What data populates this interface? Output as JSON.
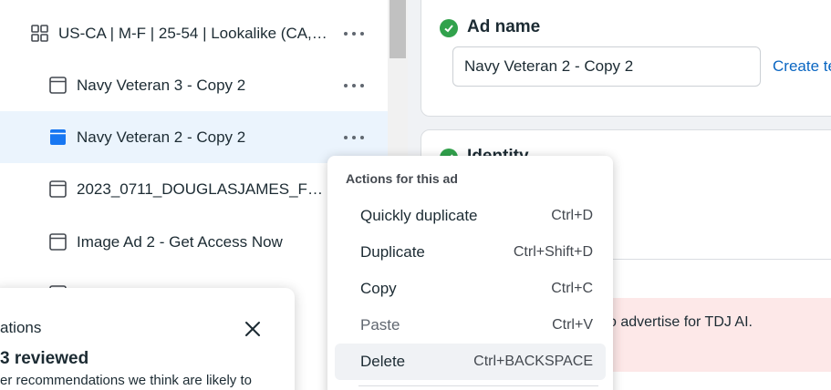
{
  "tree": {
    "rows": [
      {
        "label": "US-CA | M-F | 25-54 | Lookalike (CA, ...",
        "icon": "ad-set-grid-icon"
      },
      {
        "label": "Navy Veteran 3 - Copy 2",
        "icon": "ad-icon"
      },
      {
        "label": "Navy Veteran 2 - Copy 2",
        "icon": "ad-icon-selected"
      },
      {
        "label": "2023_0711_DOUGLASJAMES_FB...",
        "icon": "ad-icon"
      },
      {
        "label": "Image Ad 2 - Get Access Now",
        "icon": "ad-icon"
      }
    ],
    "more_icon": "more-horizontal-icon"
  },
  "editor": {
    "ad_name_title": "Ad name",
    "ad_name_value": "Navy Veteran 2 - Copy 2",
    "create_link": "Create ten",
    "identity_title": "Identity",
    "error_text": "o advertise for TDJ AI."
  },
  "menu": {
    "header": "Actions for this ad",
    "items": [
      {
        "label": "Quickly duplicate",
        "shortcut": "Ctrl+D"
      },
      {
        "label": "Duplicate",
        "shortcut": "Ctrl+Shift+D"
      },
      {
        "label": "Copy",
        "shortcut": "Ctrl+C"
      },
      {
        "label": "Paste",
        "shortcut": "Ctrl+V"
      },
      {
        "label": "Delete",
        "shortcut": "Ctrl+BACKSPACE"
      }
    ]
  },
  "recommendations": {
    "title": "ations",
    "reviewed": "3 reviewed",
    "description": "er recommendations we think are likely to"
  },
  "colors": {
    "selected_row": "#ebf4fd",
    "accent_blue": "#1877f2",
    "link_blue": "#0a66c2",
    "success_green": "#31a24c",
    "error_bg": "#fde8e8"
  }
}
